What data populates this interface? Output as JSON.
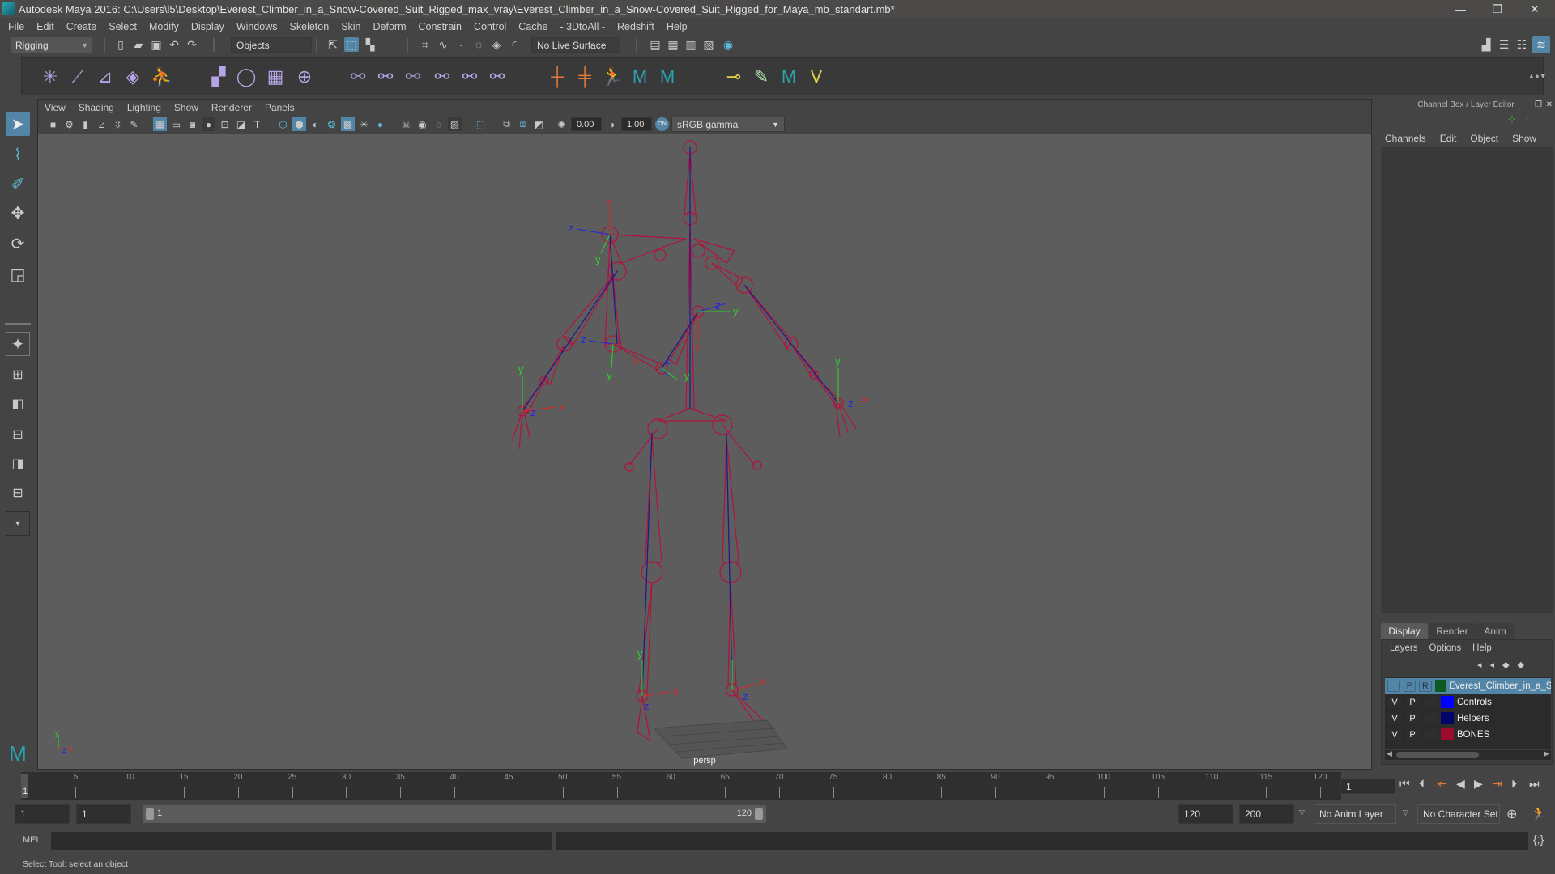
{
  "window": {
    "title": "Autodesk Maya 2016: C:\\Users\\l5\\Desktop\\Everest_Climber_in_a_Snow-Covered_Suit_Rigged_max_vray\\Everest_Climber_in_a_Snow-Covered_Suit_Rigged_for_Maya_mb_standart.mb*",
    "minimize": "—",
    "restore": "❐",
    "close": "✕"
  },
  "menu": [
    "File",
    "Edit",
    "Create",
    "Select",
    "Modify",
    "Display",
    "Windows",
    "Skeleton",
    "Skin",
    "Deform",
    "Constrain",
    "Control",
    "Cache",
    "- 3DtoAll -",
    "Redshift",
    "Help"
  ],
  "statusline": {
    "menuset": "Rigging",
    "selection_mode": "Objects",
    "live_surface": "No Live Surface"
  },
  "viewport": {
    "menu": [
      "View",
      "Shading",
      "Lighting",
      "Show",
      "Renderer",
      "Panels"
    ],
    "exposure": "0.00",
    "gamma": "1.00",
    "color_space": "sRGB gamma",
    "camera_label": "persp",
    "axis_labels": {
      "x": "x",
      "y": "y",
      "z": "z"
    }
  },
  "channel_box": {
    "title": "Channel Box / Layer Editor",
    "menu": [
      "Channels",
      "Edit",
      "Object",
      "Show"
    ],
    "layer_tabs": [
      "Display",
      "Render",
      "Anim"
    ],
    "active_layer_tab": "Display",
    "layer_menu": [
      "Layers",
      "Options",
      "Help"
    ],
    "layers": [
      {
        "v": "",
        "p": "P",
        "r": "R",
        "color": "#0d5b23",
        "name": "Everest_Climber_in_a_Snow",
        "selected": true
      },
      {
        "v": "V",
        "p": "P",
        "r": "",
        "color": "#0000ff",
        "name": "Controls",
        "selected": false
      },
      {
        "v": "V",
        "p": "P",
        "r": "",
        "color": "#02066b",
        "name": "Helpers",
        "selected": false
      },
      {
        "v": "V",
        "p": "P",
        "r": "",
        "color": "#9b0d2c",
        "name": "BONES",
        "selected": false
      }
    ]
  },
  "timeline": {
    "start": 1,
    "end": 120,
    "ticks": [
      "5",
      "10",
      "15",
      "20",
      "25",
      "30",
      "35",
      "40",
      "45",
      "50",
      "55",
      "60",
      "65",
      "70",
      "75",
      "80",
      "85",
      "90",
      "95",
      "100",
      "105",
      "110",
      "115",
      "120"
    ],
    "current_frame_marker": "1",
    "current_frame": "1"
  },
  "range": {
    "start_time": "1",
    "playback_start": "1",
    "slider_start": "1",
    "slider_end": "120",
    "playback_end": "120",
    "end_time": "200",
    "anim_layer": "No Anim Layer",
    "character_set": "No Character Set"
  },
  "command_line": {
    "language": "MEL",
    "input": "",
    "result": ""
  },
  "help_line": "Select Tool: select an object",
  "colors": {
    "accent": "#5285a6",
    "joint": "#b3123c",
    "axis_x": "#e02828",
    "axis_y": "#28d628",
    "axis_z": "#2626e0"
  }
}
